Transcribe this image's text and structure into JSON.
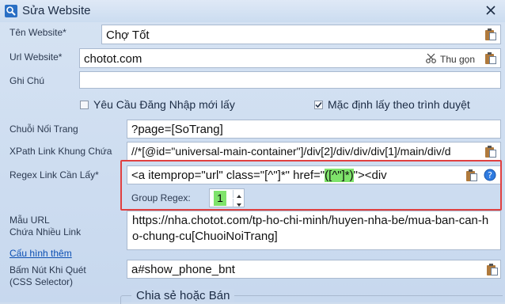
{
  "window": {
    "title": "Sửa Website"
  },
  "fields": {
    "ten_website": {
      "label": "Tên Website*",
      "value": "Chợ Tốt"
    },
    "url_website": {
      "label": "Url Website*",
      "value": "chotot.com",
      "shorten": "Thu gọn"
    },
    "ghi_chu": {
      "label": "Ghi Chú",
      "value": ""
    },
    "chuoi_noi_trang": {
      "label": "Chuỗi Nối Trang",
      "value": "?page=[SoTrang]"
    },
    "xpath_khung_chua": {
      "label": "XPath Link Khung Chứa",
      "value": "//*[@id=\"universal-main-container\"]/div[2]/div/div/div[1]/main/div/d"
    },
    "regex_link": {
      "label": "Regex Link Cần Lấy*",
      "value_prefix": "<a itemprop=\"url\" class=\"[^\"]*\" href=\"",
      "value_group": "([^\"]*)",
      "value_suffix": "\"><div"
    },
    "group_regex": {
      "label": "Group Regex:",
      "value": "1"
    },
    "mau_url": {
      "label_line1": "Mẫu URL",
      "label_line2": "Chứa Nhiều Link",
      "value": "https://nha.chotot.com/tp-ho-chi-minh/huyen-nha-be/mua-ban-can-ho-chung-cu[ChuoiNoiTrang]"
    },
    "bam_nut": {
      "label_line1": "Bấm Nút Khi Quét",
      "label_line2": "(CSS Selector)",
      "value": "a#show_phone_bnt"
    }
  },
  "checkboxes": {
    "require_login": {
      "label": "Yêu Cầu Đăng Nhập mới lấy",
      "checked": false
    },
    "default_get": {
      "label": "Mặc định lấy theo trình duyệt",
      "checked": true
    }
  },
  "links": {
    "config_more": "Cấu hình thêm"
  },
  "sections": {
    "share": "Chia sẻ hoặc Bán"
  },
  "colors": {
    "highlight": "#7fe36b",
    "redbox": "#e04040",
    "link": "#0b4fb3"
  }
}
